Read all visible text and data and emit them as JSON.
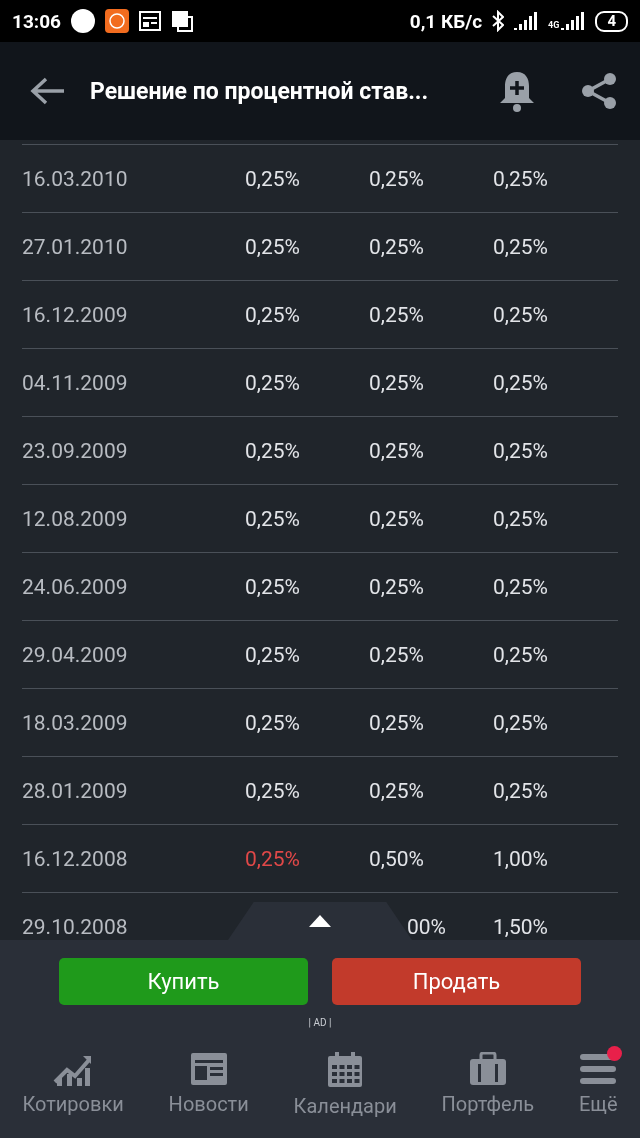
{
  "status_bar": {
    "time": "13:06",
    "speed": "0,1 КБ/с",
    "network": "4G",
    "battery": "4"
  },
  "header": {
    "title": "Решение по процентной став..."
  },
  "table": {
    "rows": [
      {
        "date": "16.03.2010",
        "actual": "0,25%",
        "forecast": "0,25%",
        "previous": "0,25%",
        "actual_down": false
      },
      {
        "date": "27.01.2010",
        "actual": "0,25%",
        "forecast": "0,25%",
        "previous": "0,25%",
        "actual_down": false
      },
      {
        "date": "16.12.2009",
        "actual": "0,25%",
        "forecast": "0,25%",
        "previous": "0,25%",
        "actual_down": false
      },
      {
        "date": "04.11.2009",
        "actual": "0,25%",
        "forecast": "0,25%",
        "previous": "0,25%",
        "actual_down": false
      },
      {
        "date": "23.09.2009",
        "actual": "0,25%",
        "forecast": "0,25%",
        "previous": "0,25%",
        "actual_down": false
      },
      {
        "date": "12.08.2009",
        "actual": "0,25%",
        "forecast": "0,25%",
        "previous": "0,25%",
        "actual_down": false
      },
      {
        "date": "24.06.2009",
        "actual": "0,25%",
        "forecast": "0,25%",
        "previous": "0,25%",
        "actual_down": false
      },
      {
        "date": "29.04.2009",
        "actual": "0,25%",
        "forecast": "0,25%",
        "previous": "0,25%",
        "actual_down": false
      },
      {
        "date": "18.03.2009",
        "actual": "0,25%",
        "forecast": "0,25%",
        "previous": "0,25%",
        "actual_down": false
      },
      {
        "date": "28.01.2009",
        "actual": "0,25%",
        "forecast": "0,25%",
        "previous": "0,25%",
        "actual_down": false
      },
      {
        "date": "16.12.2008",
        "actual": "0,25%",
        "forecast": "0,50%",
        "previous": "1,00%",
        "actual_down": true
      },
      {
        "date": "29.10.2008",
        "forecast": "00%",
        "previous": "1,50%"
      }
    ]
  },
  "actions": {
    "buy": "Купить",
    "sell": "Продать",
    "ad_label": "| AD |"
  },
  "nav": [
    {
      "kind": "quotes",
      "label": "Котировки",
      "badge": false
    },
    {
      "kind": "news",
      "label": "Новости",
      "badge": false
    },
    {
      "kind": "calendar",
      "label": "Календари",
      "badge": false
    },
    {
      "kind": "portfolio",
      "label": "Портфель",
      "badge": false
    },
    {
      "kind": "more",
      "label": "Ещё",
      "badge": true
    }
  ]
}
